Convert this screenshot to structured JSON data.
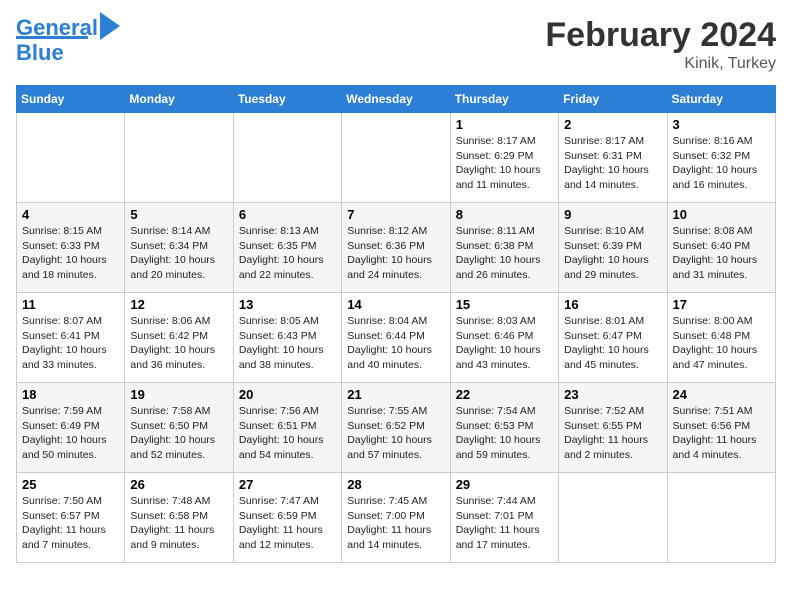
{
  "header": {
    "logo_line1": "General",
    "logo_line2": "Blue",
    "title": "February 2024",
    "subtitle": "Kinik, Turkey"
  },
  "days_of_week": [
    "Sunday",
    "Monday",
    "Tuesday",
    "Wednesday",
    "Thursday",
    "Friday",
    "Saturday"
  ],
  "weeks": [
    [
      {
        "day": "",
        "info": ""
      },
      {
        "day": "",
        "info": ""
      },
      {
        "day": "",
        "info": ""
      },
      {
        "day": "",
        "info": ""
      },
      {
        "day": "1",
        "info": "Sunrise: 8:17 AM\nSunset: 6:29 PM\nDaylight: 10 hours\nand 11 minutes."
      },
      {
        "day": "2",
        "info": "Sunrise: 8:17 AM\nSunset: 6:31 PM\nDaylight: 10 hours\nand 14 minutes."
      },
      {
        "day": "3",
        "info": "Sunrise: 8:16 AM\nSunset: 6:32 PM\nDaylight: 10 hours\nand 16 minutes."
      }
    ],
    [
      {
        "day": "4",
        "info": "Sunrise: 8:15 AM\nSunset: 6:33 PM\nDaylight: 10 hours\nand 18 minutes."
      },
      {
        "day": "5",
        "info": "Sunrise: 8:14 AM\nSunset: 6:34 PM\nDaylight: 10 hours\nand 20 minutes."
      },
      {
        "day": "6",
        "info": "Sunrise: 8:13 AM\nSunset: 6:35 PM\nDaylight: 10 hours\nand 22 minutes."
      },
      {
        "day": "7",
        "info": "Sunrise: 8:12 AM\nSunset: 6:36 PM\nDaylight: 10 hours\nand 24 minutes."
      },
      {
        "day": "8",
        "info": "Sunrise: 8:11 AM\nSunset: 6:38 PM\nDaylight: 10 hours\nand 26 minutes."
      },
      {
        "day": "9",
        "info": "Sunrise: 8:10 AM\nSunset: 6:39 PM\nDaylight: 10 hours\nand 29 minutes."
      },
      {
        "day": "10",
        "info": "Sunrise: 8:08 AM\nSunset: 6:40 PM\nDaylight: 10 hours\nand 31 minutes."
      }
    ],
    [
      {
        "day": "11",
        "info": "Sunrise: 8:07 AM\nSunset: 6:41 PM\nDaylight: 10 hours\nand 33 minutes."
      },
      {
        "day": "12",
        "info": "Sunrise: 8:06 AM\nSunset: 6:42 PM\nDaylight: 10 hours\nand 36 minutes."
      },
      {
        "day": "13",
        "info": "Sunrise: 8:05 AM\nSunset: 6:43 PM\nDaylight: 10 hours\nand 38 minutes."
      },
      {
        "day": "14",
        "info": "Sunrise: 8:04 AM\nSunset: 6:44 PM\nDaylight: 10 hours\nand 40 minutes."
      },
      {
        "day": "15",
        "info": "Sunrise: 8:03 AM\nSunset: 6:46 PM\nDaylight: 10 hours\nand 43 minutes."
      },
      {
        "day": "16",
        "info": "Sunrise: 8:01 AM\nSunset: 6:47 PM\nDaylight: 10 hours\nand 45 minutes."
      },
      {
        "day": "17",
        "info": "Sunrise: 8:00 AM\nSunset: 6:48 PM\nDaylight: 10 hours\nand 47 minutes."
      }
    ],
    [
      {
        "day": "18",
        "info": "Sunrise: 7:59 AM\nSunset: 6:49 PM\nDaylight: 10 hours\nand 50 minutes."
      },
      {
        "day": "19",
        "info": "Sunrise: 7:58 AM\nSunset: 6:50 PM\nDaylight: 10 hours\nand 52 minutes."
      },
      {
        "day": "20",
        "info": "Sunrise: 7:56 AM\nSunset: 6:51 PM\nDaylight: 10 hours\nand 54 minutes."
      },
      {
        "day": "21",
        "info": "Sunrise: 7:55 AM\nSunset: 6:52 PM\nDaylight: 10 hours\nand 57 minutes."
      },
      {
        "day": "22",
        "info": "Sunrise: 7:54 AM\nSunset: 6:53 PM\nDaylight: 10 hours\nand 59 minutes."
      },
      {
        "day": "23",
        "info": "Sunrise: 7:52 AM\nSunset: 6:55 PM\nDaylight: 11 hours\nand 2 minutes."
      },
      {
        "day": "24",
        "info": "Sunrise: 7:51 AM\nSunset: 6:56 PM\nDaylight: 11 hours\nand 4 minutes."
      }
    ],
    [
      {
        "day": "25",
        "info": "Sunrise: 7:50 AM\nSunset: 6:57 PM\nDaylight: 11 hours\nand 7 minutes."
      },
      {
        "day": "26",
        "info": "Sunrise: 7:48 AM\nSunset: 6:58 PM\nDaylight: 11 hours\nand 9 minutes."
      },
      {
        "day": "27",
        "info": "Sunrise: 7:47 AM\nSunset: 6:59 PM\nDaylight: 11 hours\nand 12 minutes."
      },
      {
        "day": "28",
        "info": "Sunrise: 7:45 AM\nSunset: 7:00 PM\nDaylight: 11 hours\nand 14 minutes."
      },
      {
        "day": "29",
        "info": "Sunrise: 7:44 AM\nSunset: 7:01 PM\nDaylight: 11 hours\nand 17 minutes."
      },
      {
        "day": "",
        "info": ""
      },
      {
        "day": "",
        "info": ""
      }
    ]
  ]
}
